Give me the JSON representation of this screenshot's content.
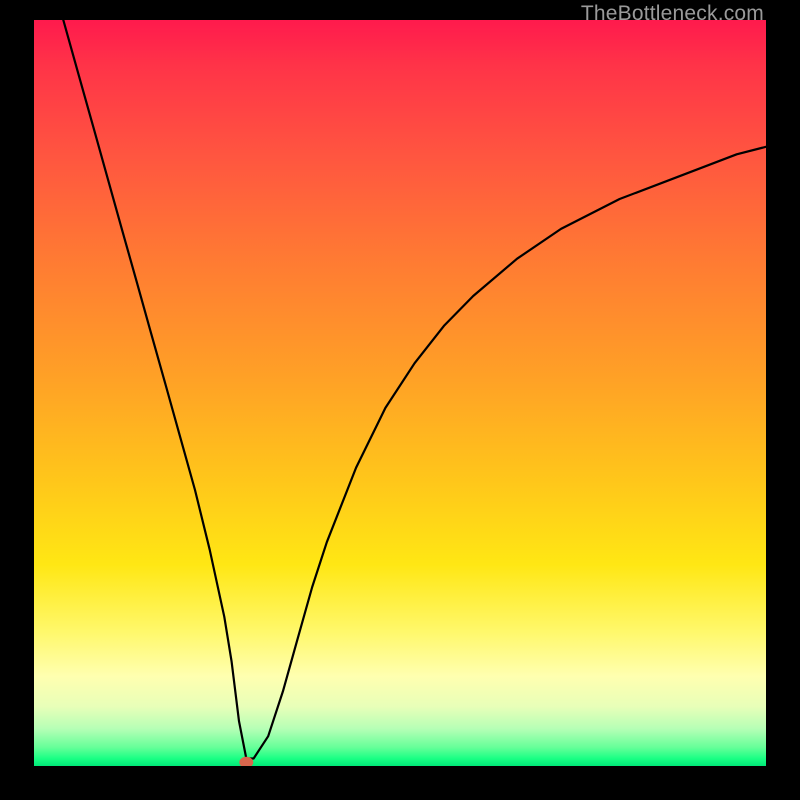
{
  "watermark": "TheBottleneck.com",
  "colors": {
    "frame": "#000000",
    "curve": "#000000",
    "marker": "#d9664d",
    "gradient_top": "#ff1a4d",
    "gradient_bottom": "#00e878"
  },
  "chart_data": {
    "type": "line",
    "title": "",
    "xlabel": "",
    "ylabel": "",
    "xlim": [
      0,
      100
    ],
    "ylim": [
      0,
      100
    ],
    "grid": false,
    "legend": false,
    "series": [
      {
        "name": "bottleneck-curve",
        "x": [
          4,
          6,
          8,
          10,
          12,
          14,
          16,
          18,
          20,
          22,
          24,
          26,
          27,
          28,
          29,
          30,
          32,
          34,
          36,
          38,
          40,
          44,
          48,
          52,
          56,
          60,
          66,
          72,
          80,
          88,
          96,
          100
        ],
        "values": [
          100,
          93,
          86,
          79,
          72,
          65,
          58,
          51,
          44,
          37,
          29,
          20,
          14,
          6,
          1,
          1,
          4,
          10,
          17,
          24,
          30,
          40,
          48,
          54,
          59,
          63,
          68,
          72,
          76,
          79,
          82,
          83
        ]
      }
    ],
    "markers": [
      {
        "name": "minimum-point",
        "x": 29,
        "y": 0.5
      }
    ],
    "background": {
      "type": "vertical-gradient",
      "stops": [
        {
          "pos": 0.0,
          "color": "#ff1a4d"
        },
        {
          "pos": 0.18,
          "color": "#ff5540"
        },
        {
          "pos": 0.48,
          "color": "#ffa126"
        },
        {
          "pos": 0.73,
          "color": "#ffe714"
        },
        {
          "pos": 0.88,
          "color": "#ffffb0"
        },
        {
          "pos": 0.97,
          "color": "#66ff99"
        },
        {
          "pos": 1.0,
          "color": "#00e878"
        }
      ]
    }
  }
}
